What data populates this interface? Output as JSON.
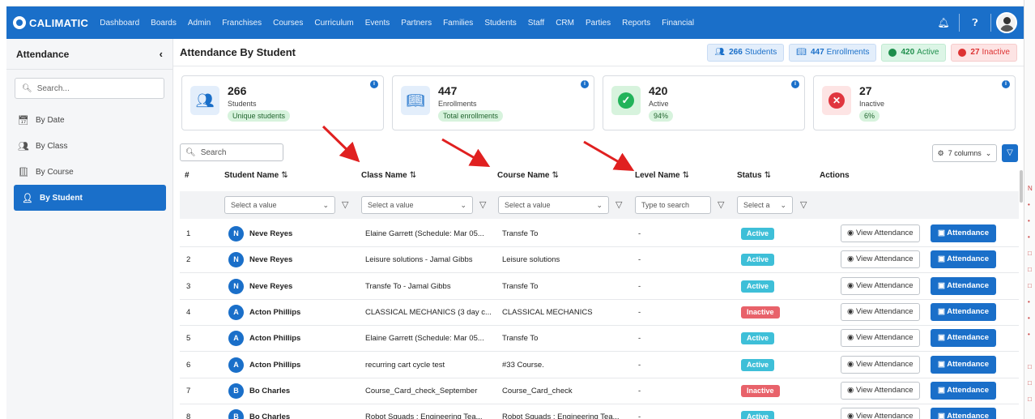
{
  "nav": {
    "brand": "CALIMATIC",
    "items": [
      "Dashboard",
      "Boards",
      "Admin",
      "Franchises",
      "Courses",
      "Curriculum",
      "Events",
      "Partners",
      "Families",
      "Students",
      "Staff",
      "CRM",
      "Parties",
      "Reports",
      "Financial"
    ]
  },
  "sidebar": {
    "title": "Attendance",
    "search_placeholder": "Search...",
    "items": [
      {
        "label": "By Date",
        "icon": "calendar-icon"
      },
      {
        "label": "By Class",
        "icon": "group-icon"
      },
      {
        "label": "By Course",
        "icon": "book-icon"
      },
      {
        "label": "By Student",
        "icon": "user-icon",
        "active": true
      }
    ]
  },
  "header": {
    "title": "Attendance By Student",
    "badges": {
      "students": {
        "num": "266",
        "label": "Students"
      },
      "enrollments": {
        "num": "447",
        "label": "Enrollments"
      },
      "active": {
        "num": "420",
        "label": "Active"
      },
      "inactive": {
        "num": "27",
        "label": "Inactive"
      }
    }
  },
  "cards": [
    {
      "num": "266",
      "label": "Students",
      "pill": "Unique students",
      "icon": "students-icon"
    },
    {
      "num": "447",
      "label": "Enrollments",
      "pill": "Total enrollments",
      "icon": "book-open-icon"
    },
    {
      "num": "420",
      "label": "Active",
      "pill": "94%",
      "icon": "check-circle-icon"
    },
    {
      "num": "27",
      "label": "Inactive",
      "pill": "6%",
      "icon": "x-circle-icon"
    }
  ],
  "toolbar": {
    "search_placeholder": "Search",
    "columns_label": "7 columns"
  },
  "table": {
    "headers": {
      "num": "#",
      "student": "Student Name",
      "class": "Class Name",
      "course": "Course Name",
      "level": "Level Name",
      "status": "Status",
      "actions": "Actions"
    },
    "filters": {
      "student": "Select a value",
      "class": "Select a value",
      "course": "Select a value",
      "level": "Type to search",
      "status": "Select a"
    },
    "view_label": "View Attendance",
    "attendance_label": "Attendance",
    "rows": [
      {
        "n": "1",
        "initial": "N",
        "name": "Neve Reyes",
        "cls": "Elaine Garrett (Schedule: Mar 05...",
        "course": "Transfe To",
        "level": "-",
        "status": "Active"
      },
      {
        "n": "2",
        "initial": "N",
        "name": "Neve Reyes",
        "cls": "Leisure solutions - Jamal Gibbs",
        "course": "Leisure solutions",
        "level": "-",
        "status": "Active"
      },
      {
        "n": "3",
        "initial": "N",
        "name": "Neve Reyes",
        "cls": "Transfe To - Jamal Gibbs",
        "course": "Transfe To",
        "level": "-",
        "status": "Active"
      },
      {
        "n": "4",
        "initial": "A",
        "name": "Acton Phillips",
        "cls": "CLASSICAL MECHANICS (3 day c...",
        "course": "CLASSICAL MECHANICS",
        "level": "-",
        "status": "Inactive"
      },
      {
        "n": "5",
        "initial": "A",
        "name": "Acton Phillips",
        "cls": "Elaine Garrett (Schedule: Mar 05...",
        "course": "Transfe To",
        "level": "-",
        "status": "Active"
      },
      {
        "n": "6",
        "initial": "A",
        "name": "Acton Phillips",
        "cls": "recurring cart cycle test",
        "course": "#33 Course.",
        "level": "-",
        "status": "Active"
      },
      {
        "n": "7",
        "initial": "B",
        "name": "Bo Charles",
        "cls": "Course_Card_check_September",
        "course": "Course_Card_check",
        "level": "-",
        "status": "Inactive"
      },
      {
        "n": "8",
        "initial": "B",
        "name": "Bo Charles",
        "cls": "Robot Squads : Engineering Tea...",
        "course": "Robot Squads : Engineering Tea...",
        "level": "-",
        "status": "Active"
      }
    ]
  },
  "colors": {
    "primary": "#1a6fc9",
    "active": "#3ebfd8",
    "inactive": "#e8626a",
    "annotation_arrow": "#e02020"
  }
}
